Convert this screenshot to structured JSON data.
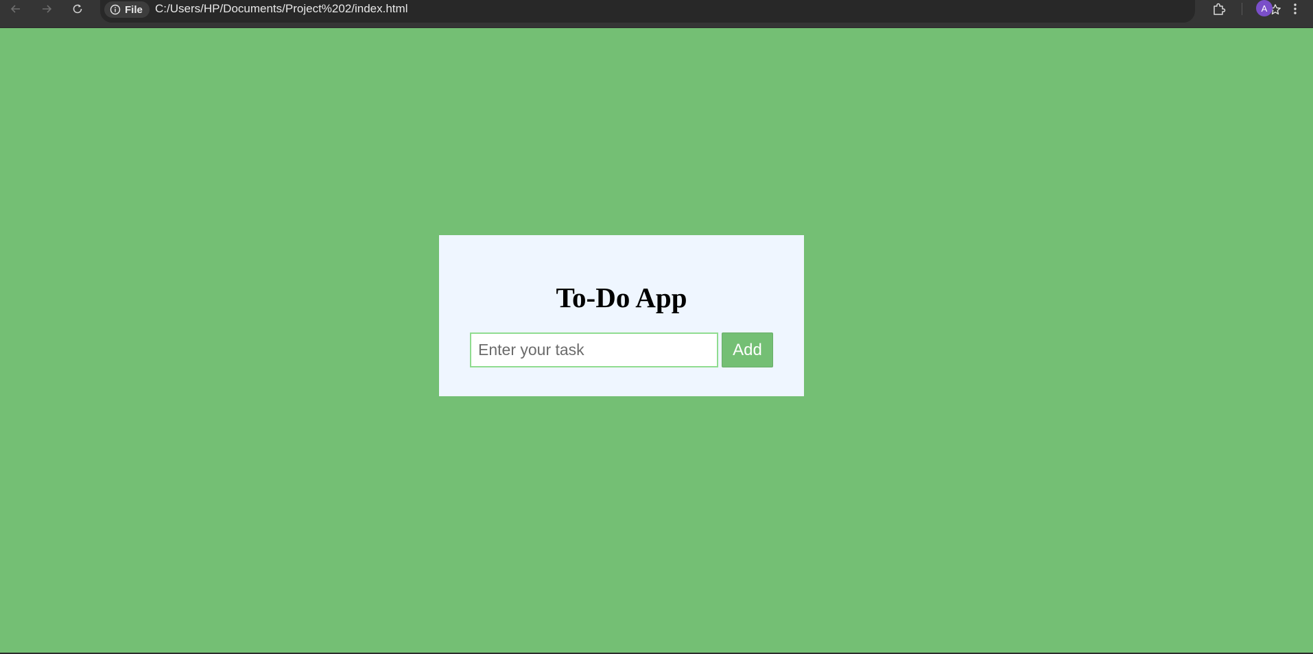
{
  "browser": {
    "back_icon": "arrow-left-icon",
    "forward_icon": "arrow-right-icon",
    "reload_icon": "reload-icon",
    "site_info_icon": "info-icon",
    "site_chip_label": "File",
    "url": "C:/Users/HP/Documents/Project%202/index.html",
    "bookmark_icon": "star-icon",
    "extensions_icon": "puzzle-icon",
    "profile_initial": "A",
    "menu_icon": "kebab-menu-icon"
  },
  "app": {
    "title": "To-Do App",
    "task_input": {
      "placeholder": "Enter your task",
      "value": ""
    },
    "add_button_label": "Add"
  },
  "colors": {
    "page_background": "#74bf74",
    "card_background": "#eff6ff",
    "input_border": "#8fdc8f",
    "button_background": "#74bf74",
    "avatar": "#7a4fc9"
  }
}
